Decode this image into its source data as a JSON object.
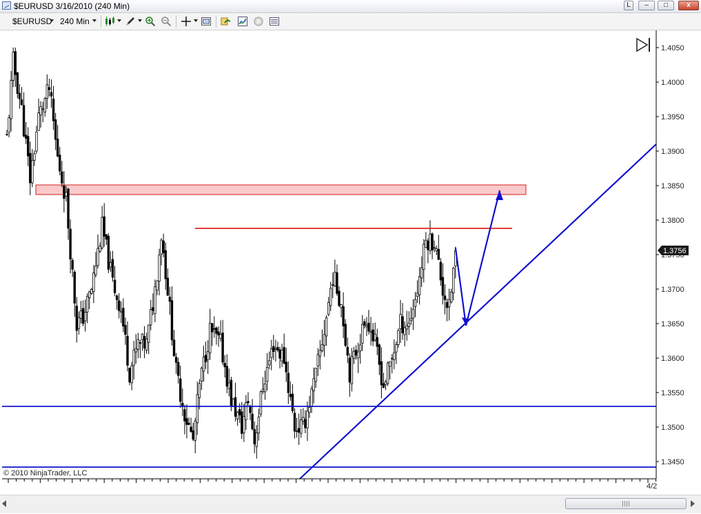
{
  "window": {
    "title": "$EURUSD  3/16/2010 (240 Min)",
    "buttons": {
      "link": "L",
      "minimize": "–",
      "maximize": "□",
      "close": "x"
    }
  },
  "toolbar": {
    "instrument": "$EURUSD",
    "period": "240 Min",
    "icons": [
      "bar-style-icon",
      "draw-tool-icon",
      "zoom-in-icon",
      "zoom-out-icon",
      "crosshair-icon",
      "properties-icon",
      "indicators-icon",
      "strategies-icon",
      "chart-trader-icon",
      "data-box-icon"
    ]
  },
  "chart": {
    "last_price": "1.3756",
    "copyright": "© 2010 NinjaTrader, LLC",
    "date_label": "4/2",
    "colors": {
      "candle": "#000000",
      "zone_fill": "#f9c9c9",
      "zone_stroke": "#d62020",
      "resistance": "#e02020",
      "trendline": "#1010d0",
      "price_tag": "#1a1a1a"
    }
  },
  "chart_data": {
    "type": "candlestick",
    "ylim": [
      1.3425,
      1.4075
    ],
    "y_ticks": [
      "1.4050",
      "1.4000",
      "1.3950",
      "1.3900",
      "1.3850",
      "1.3800",
      "1.3750",
      "1.3700",
      "1.3650",
      "1.3600",
      "1.3550",
      "1.3500",
      "1.3450"
    ],
    "x_ticks": [
      "4/2"
    ],
    "supply_zone": [
      1.3837,
      1.3851
    ],
    "resistance_level": 1.3788,
    "support_levels": [
      1.353,
      1.3442
    ],
    "keypoints": [
      [
        0,
        1.392
      ],
      [
        3,
        1.403
      ],
      [
        7,
        1.396
      ],
      [
        11,
        1.386
      ],
      [
        15,
        1.395
      ],
      [
        20,
        1.399
      ],
      [
        24,
        1.389
      ],
      [
        28,
        1.383
      ],
      [
        33,
        1.365
      ],
      [
        36,
        1.366
      ],
      [
        40,
        1.37
      ],
      [
        45,
        1.379
      ],
      [
        50,
        1.371
      ],
      [
        54,
        1.367
      ],
      [
        58,
        1.358
      ],
      [
        62,
        1.362
      ],
      [
        66,
        1.362
      ],
      [
        70,
        1.37
      ],
      [
        73,
        1.378
      ],
      [
        76,
        1.37
      ],
      [
        80,
        1.358
      ],
      [
        84,
        1.352
      ],
      [
        88,
        1.348
      ],
      [
        91,
        1.356
      ],
      [
        96,
        1.364
      ],
      [
        101,
        1.362
      ],
      [
        106,
        1.354
      ],
      [
        111,
        1.35
      ],
      [
        114,
        1.354
      ],
      [
        117,
        1.348
      ],
      [
        121,
        1.356
      ],
      [
        126,
        1.362
      ],
      [
        131,
        1.36
      ],
      [
        136,
        1.35
      ],
      [
        140,
        1.35
      ],
      [
        145,
        1.356
      ],
      [
        150,
        1.364
      ],
      [
        154,
        1.372
      ],
      [
        158,
        1.368
      ],
      [
        162,
        1.358
      ],
      [
        166,
        1.362
      ],
      [
        170,
        1.366
      ],
      [
        174,
        1.362
      ],
      [
        178,
        1.356
      ],
      [
        182,
        1.36
      ],
      [
        186,
        1.365
      ],
      [
        190,
        1.365
      ],
      [
        194,
        1.37
      ],
      [
        198,
        1.377
      ],
      [
        202,
        1.377
      ],
      [
        206,
        1.37
      ],
      [
        209,
        1.367
      ],
      [
        212,
        1.3756
      ]
    ]
  }
}
